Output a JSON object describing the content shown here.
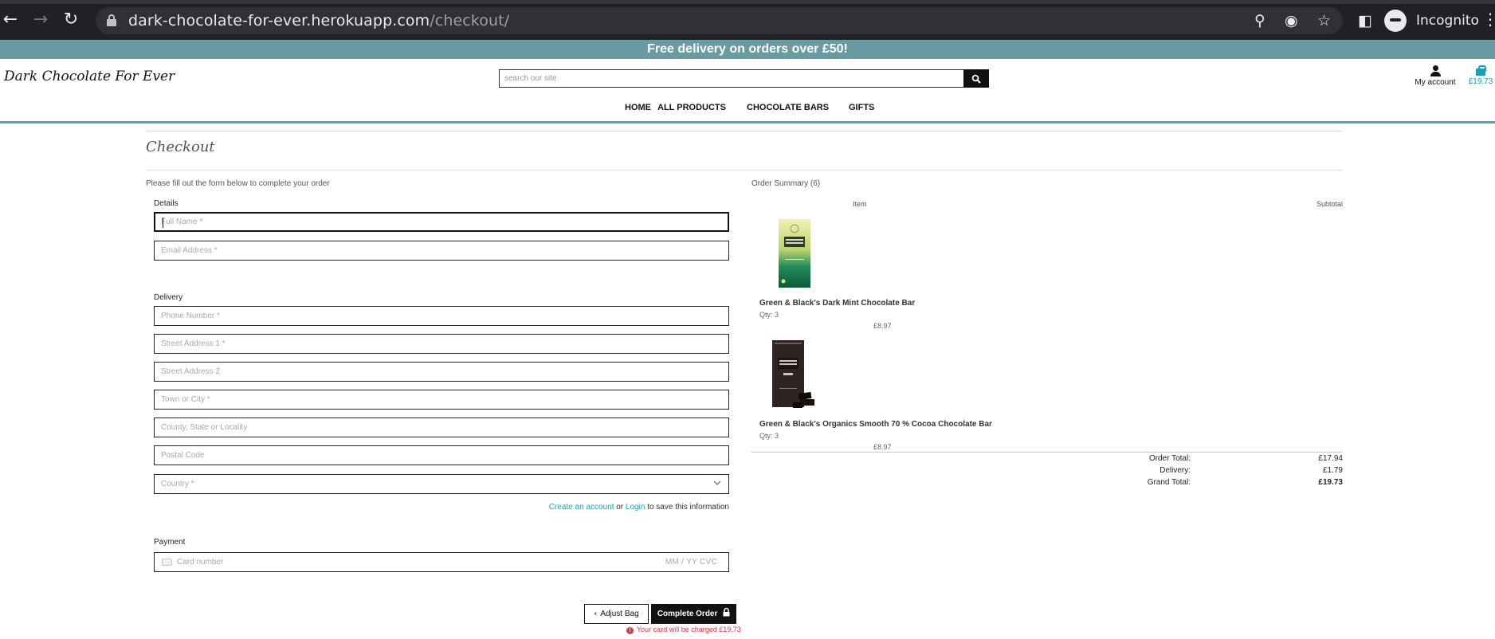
{
  "browser": {
    "url_host": "dark-chocolate-for-ever.herokuapp.com",
    "url_path": "/checkout/",
    "profile_label": "Incognito",
    "icons": [
      "back-icon",
      "forward-icon",
      "reload-icon",
      "lock-icon",
      "zoom-icon",
      "eye-off-icon",
      "star-icon",
      "sidepanel-icon",
      "incognito-icon",
      "kebab-menu-icon"
    ]
  },
  "banner": {
    "text": "Free delivery on orders over £50!"
  },
  "header": {
    "logo": "Dark Chocolate For Ever",
    "search_placeholder": "search our site",
    "account_label": "My account",
    "bag_total": "£19.73",
    "nav": [
      "HOME",
      "ALL PRODUCTS",
      "CHOCOLATE BARS",
      "GIFTS"
    ]
  },
  "checkout": {
    "title": "Checkout",
    "intro": "Please fill out the form below to complete your order",
    "details_label": "Details",
    "delivery_label": "Delivery",
    "payment_label": "Payment",
    "fields": {
      "full_name": "Full Name *",
      "email": "Email Address *",
      "phone": "Phone Number *",
      "street1": "Street Address 1 *",
      "street2": "Street Address 2",
      "town": "Town or City *",
      "county": "County, State or Locality",
      "postcode": "Postal Code",
      "country": "Country *"
    },
    "save_info": {
      "create_account": "Create an account",
      "or": " or ",
      "login": "Login",
      "suffix": " to save this information"
    },
    "card": {
      "number_placeholder": "Card number",
      "right_placeholder": "MM / YY  CVC"
    },
    "adjust_bag": "Adjust Bag",
    "complete_order": "Complete Order",
    "charge_notice": "Your card will be charged £19.73"
  },
  "summary": {
    "title": "Order Summary (6)",
    "col_item": "Item",
    "col_subtotal": "Subtotal",
    "items": [
      {
        "name": "Green & Black's Dark Mint Chocolate Bar",
        "qty": "Qty: 3",
        "price": "£8.97"
      },
      {
        "name": "Green & Black's Organics Smooth 70 % Cocoa Chocolate Bar",
        "qty": "Qty: 3",
        "price": "£8.97"
      }
    ],
    "order_total_label": "Order Total:",
    "order_total": "£17.94",
    "delivery_label": "Delivery:",
    "delivery": "£1.79",
    "grand_total_label": "Grand Total:",
    "grand_total": "£19.73"
  },
  "colors": {
    "banner": "#6a9ba2",
    "link": "#17a2b8",
    "error": "#dc3545"
  }
}
